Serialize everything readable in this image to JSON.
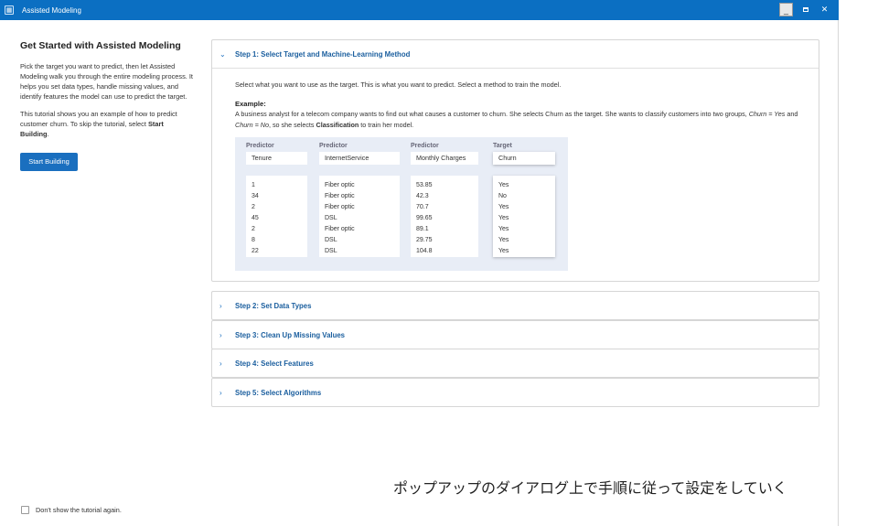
{
  "window": {
    "title": "Assisted Modeling",
    "app_icon": "app-icon",
    "controls": [
      "minimize",
      "maximize",
      "close"
    ]
  },
  "left": {
    "heading": "Get Started with Assisted Modeling",
    "para1": "Pick the target you want to predict, then let Assisted Modeling walk you through the entire modeling process. It helps you set data types, handle missing values, and identify features the model can use to predict the target.",
    "para2_prefix": "This tutorial shows you an example of how to predict customer churn. To skip the tutorial, select ",
    "para2_bold": "Start Building",
    "para2_suffix": ".",
    "start_button": "Start Building"
  },
  "footer": {
    "checkbox_label": "Don't show the tutorial again."
  },
  "steps": [
    {
      "label": "Step 1: Select Target and Machine-Learning Method",
      "expanded": true
    },
    {
      "label": "Step 2: Set Data Types",
      "expanded": false
    },
    {
      "label": "Step 3: Clean Up Missing Values",
      "expanded": false
    },
    {
      "label": "Step 4: Select Features",
      "expanded": false
    },
    {
      "label": "Step 5: Select Algorithms",
      "expanded": false
    }
  ],
  "step1": {
    "intro": "Select what you want to use as the target. This is what you want to predict. Select a method to train the model.",
    "example_heading": "Example:",
    "example_text_1": "A business analyst for a telecom company wants to find out what causes a customer to churn. She selects Churn as the target. She wants to classify customers into two groups,",
    "example_italic_1": "Churn = Yes",
    "example_and": " and ",
    "example_italic_2": "Churn = No",
    "example_text_2": ", so she selects ",
    "example_bold": "Classification",
    "example_text_3": " to train her model."
  },
  "example_table": {
    "columns": [
      {
        "role": "Predictor",
        "name": "Tenure",
        "values": [
          "1",
          "34",
          "2",
          "45",
          "2",
          "8",
          "22"
        ]
      },
      {
        "role": "Predictor",
        "name": "InternetService",
        "values": [
          "Fiber optic",
          "Fiber optic",
          "Fiber optic",
          "DSL",
          "Fiber optic",
          "DSL",
          "DSL"
        ]
      },
      {
        "role": "Predictor",
        "name": "Monthly Charges",
        "values": [
          "53.85",
          "42.3",
          "70.7",
          "99.65",
          "89.1",
          "29.75",
          "104.8"
        ]
      },
      {
        "role": "Target",
        "name": "Churn",
        "values": [
          "Yes",
          "No",
          "Yes",
          "Yes",
          "Yes",
          "Yes",
          "Yes"
        ]
      }
    ]
  },
  "caption": "ポップアップのダイアログ上で手順に従って設定をしていく",
  "colors": {
    "titlebar": "#0b6fc2",
    "accent": "#1a6fbf",
    "step_label": "#1a5e9e",
    "example_panel": "#e8edf6"
  }
}
